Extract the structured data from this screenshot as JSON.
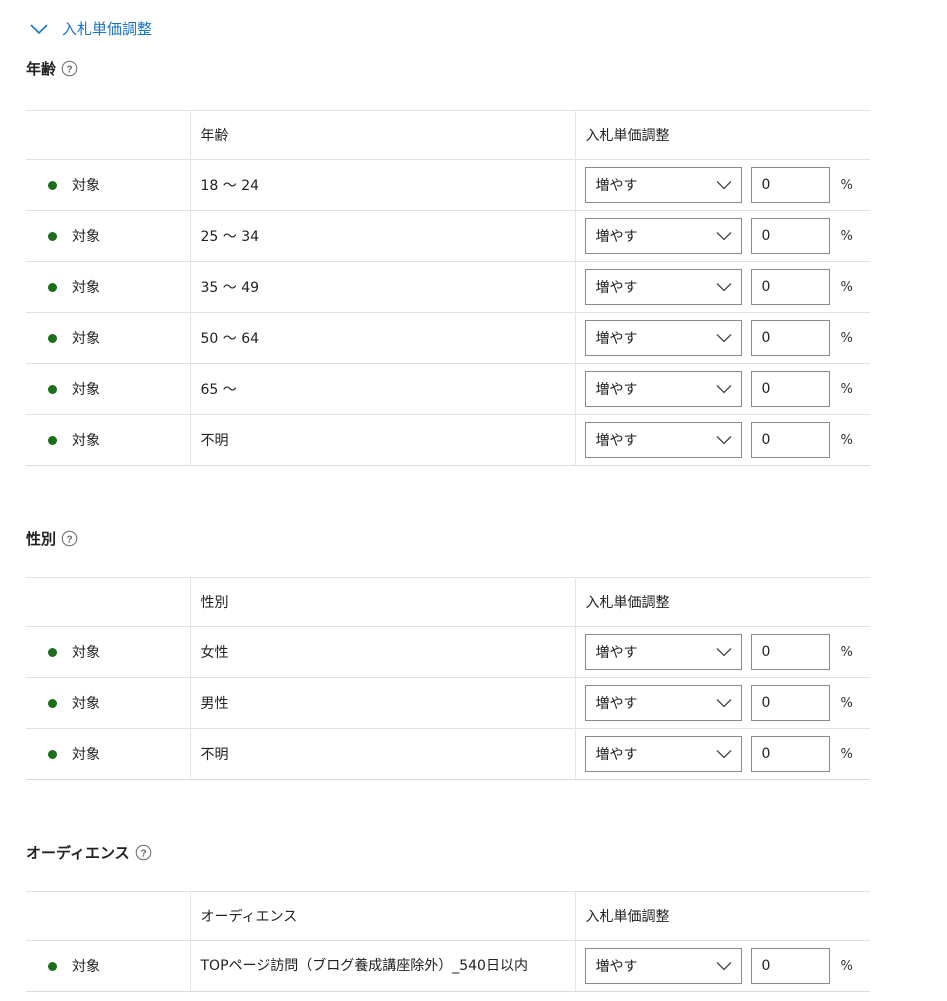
{
  "section": {
    "title": "入札単価調整"
  },
  "groups": [
    {
      "title": "年齢",
      "col_segment": "年齢",
      "col_adjust": "入札単価調整",
      "rows": [
        {
          "status": "対象",
          "segment": "18 ～ 24",
          "direction": "増やす",
          "value": "0",
          "unit": "%"
        },
        {
          "status": "対象",
          "segment": "25 ～ 34",
          "direction": "増やす",
          "value": "0",
          "unit": "%"
        },
        {
          "status": "対象",
          "segment": "35 ～ 49",
          "direction": "増やす",
          "value": "0",
          "unit": "%"
        },
        {
          "status": "対象",
          "segment": "50 ～ 64",
          "direction": "増やす",
          "value": "0",
          "unit": "%"
        },
        {
          "status": "対象",
          "segment": "65 ～",
          "direction": "増やす",
          "value": "0",
          "unit": "%"
        },
        {
          "status": "対象",
          "segment": "不明",
          "direction": "増やす",
          "value": "0",
          "unit": "%"
        }
      ]
    },
    {
      "title": "性別",
      "col_segment": "性別",
      "col_adjust": "入札単価調整",
      "rows": [
        {
          "status": "対象",
          "segment": "女性",
          "direction": "増やす",
          "value": "0",
          "unit": "%"
        },
        {
          "status": "対象",
          "segment": "男性",
          "direction": "増やす",
          "value": "0",
          "unit": "%"
        },
        {
          "status": "対象",
          "segment": "不明",
          "direction": "増やす",
          "value": "0",
          "unit": "%"
        }
      ]
    },
    {
      "title": "オーディエンス",
      "col_segment": "オーディエンス",
      "col_adjust": "入札単価調整",
      "rows": [
        {
          "status": "対象",
          "segment": "TOPページ訪問（ブログ養成講座除外）_540日以内",
          "direction": "増やす",
          "value": "0",
          "unit": "%"
        }
      ]
    }
  ],
  "colors": {
    "link": "#1a73c8",
    "status_dot": "#1b6e1b"
  }
}
